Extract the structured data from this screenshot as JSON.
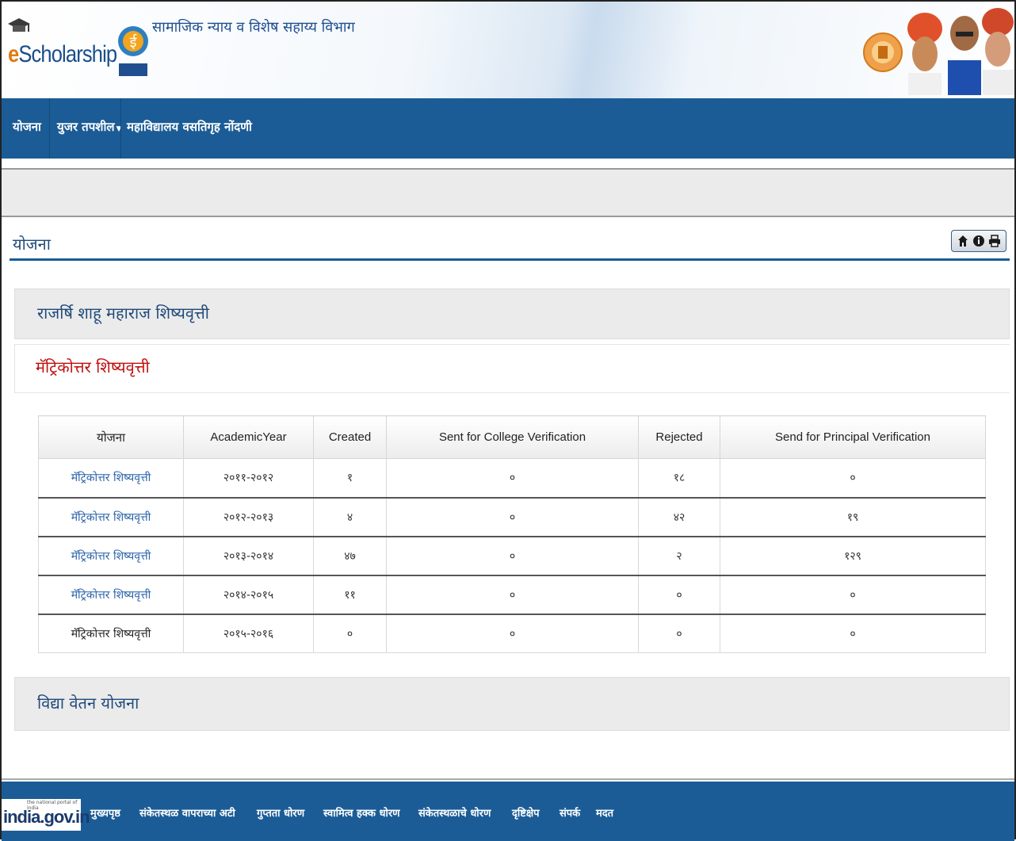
{
  "header": {
    "logo_text": "eScholarship",
    "dept_name": "सामाजिक न्याय व विशेष सहाय्य विभाग"
  },
  "nav": {
    "items": [
      {
        "label": "योजना"
      },
      {
        "label": "युजर तपशील"
      },
      {
        "label": "महाविद्यालय वसतिगृह नोंदणी"
      }
    ]
  },
  "page": {
    "title": "योजना"
  },
  "toolbar": {
    "icons": [
      "home-icon",
      "info-icon",
      "print-icon"
    ]
  },
  "section1": {
    "title": "राजर्षि शाहू महाराज शिष्यवृत्ती",
    "subsection_title": "मॅट्रिकोत्तर शिष्यवृत्ती"
  },
  "table": {
    "headers": [
      "योजना",
      "AcademicYear",
      "Created",
      "Sent for College Verification",
      "Rejected",
      "Send for Principal Verification"
    ],
    "rows": [
      {
        "scheme": "मॅट्रिकोत्तर शिष्यवृत्ती",
        "year": "२०११-२०१२",
        "created": "१",
        "sent_college": "०",
        "rejected": "१८",
        "sent_principal": "०",
        "link": true
      },
      {
        "scheme": "मॅट्रिकोत्तर शिष्यवृत्ती",
        "year": "२०१२-२०१३",
        "created": "४",
        "sent_college": "०",
        "rejected": "४२",
        "sent_principal": "१९",
        "link": true
      },
      {
        "scheme": "मॅट्रिकोत्तर शिष्यवृत्ती",
        "year": "२०१३-२०१४",
        "created": "४७",
        "sent_college": "०",
        "rejected": "२",
        "sent_principal": "१२९",
        "link": true
      },
      {
        "scheme": "मॅट्रिकोत्तर शिष्यवृत्ती",
        "year": "२०१४-२०१५",
        "created": "११",
        "sent_college": "०",
        "rejected": "०",
        "sent_principal": "०",
        "link": true
      },
      {
        "scheme": "मॅट्रिकोत्तर शिष्यवृत्ती",
        "year": "२०१५-२०१६",
        "created": "०",
        "sent_college": "०",
        "rejected": "०",
        "sent_principal": "०",
        "link": false
      }
    ]
  },
  "section2": {
    "title": "विद्या वेतन योजना"
  },
  "footer": {
    "logo_text": "india.gov.in",
    "logo_tagline": "the national portal of india",
    "links": [
      "मुख्यपृष्ठ",
      "संकेतस्थळ वापराच्या अटी",
      "गुप्तता धोरण",
      "स्वामित्व हक्क धोरण",
      "संकेतस्थळाचे धोरण",
      "दृष्टिक्षेप",
      "संपर्क",
      "मदत"
    ]
  },
  "colors": {
    "nav_bg": "#1b5c96",
    "title_text": "#1f4a7a",
    "subsection_red": "#c01010",
    "link": "#2a63a8"
  }
}
